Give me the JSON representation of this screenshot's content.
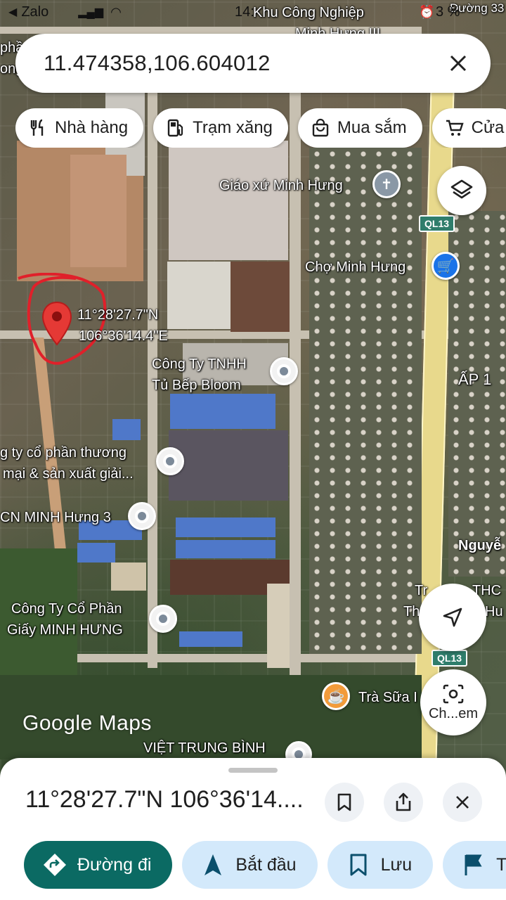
{
  "status_bar": {
    "back_app": "Zalo",
    "time_fragment": "14:",
    "battery_fragment": "3 %"
  },
  "search": {
    "value": "11.474358,106.604012"
  },
  "chips": [
    {
      "label": "Nhà hàng",
      "icon": "restaurant-icon"
    },
    {
      "label": "Trạm xăng",
      "icon": "gas-station-icon"
    },
    {
      "label": "Mua sắm",
      "icon": "shopping-bag-icon"
    },
    {
      "label": "Cửa",
      "icon": "cart-icon"
    }
  ],
  "map": {
    "labels": {
      "top_poi_line1": "Khu Công Nghiệp",
      "top_poi_line2": "Minh Hưng III",
      "road_top_right": "Đường 33",
      "left_edge_1": "phầ",
      "left_edge_2": "ong",
      "church": "Giáo xứ Minh Hưng",
      "highway_1": "QL13",
      "market": "Chợ Minh Hưng",
      "dropped_pin_lat": "11°28'27.7\"N",
      "dropped_pin_lng": "106°36'14.4\"E",
      "bloom_line1": "Công Ty TNHH",
      "bloom_line2": "Tủ Bếp Bloom",
      "hamlet": "ẤP 1",
      "company_line1": "g ty cổ phần thương",
      "company_line2": "mại & sản xuất giải...",
      "kcn": "CN MINH Hưng 3",
      "nguyen": "Nguyễ",
      "school_1": "Tr",
      "school_2": "THC",
      "school_3": "Th",
      "school_4": "Hu",
      "paper_line1": "Công Ty Cổ Phần",
      "paper_line2": "Giấy MINH HƯNG",
      "highway_2": "QL13",
      "tea": "Trà Sữa I",
      "bottom_poi": "VIỆT TRUNG BÌNH"
    },
    "logo": "Google Maps"
  },
  "lens": {
    "label": "Ch...em"
  },
  "sheet": {
    "title": "11°28'27.7\"N 106°36'14....",
    "actions": [
      {
        "label": "Đường đi",
        "icon": "directions-icon"
      },
      {
        "label": "Bắt đầu",
        "icon": "navigation-arrow-icon"
      },
      {
        "label": "Lưu",
        "icon": "bookmark-icon"
      },
      {
        "label": "T",
        "icon": "flag-icon"
      }
    ]
  },
  "colors": {
    "primary_action": "#0b6a63",
    "secondary_action": "#d3e9fb",
    "marker_red": "#e53935",
    "highway_yellow": "#e8d98c"
  }
}
